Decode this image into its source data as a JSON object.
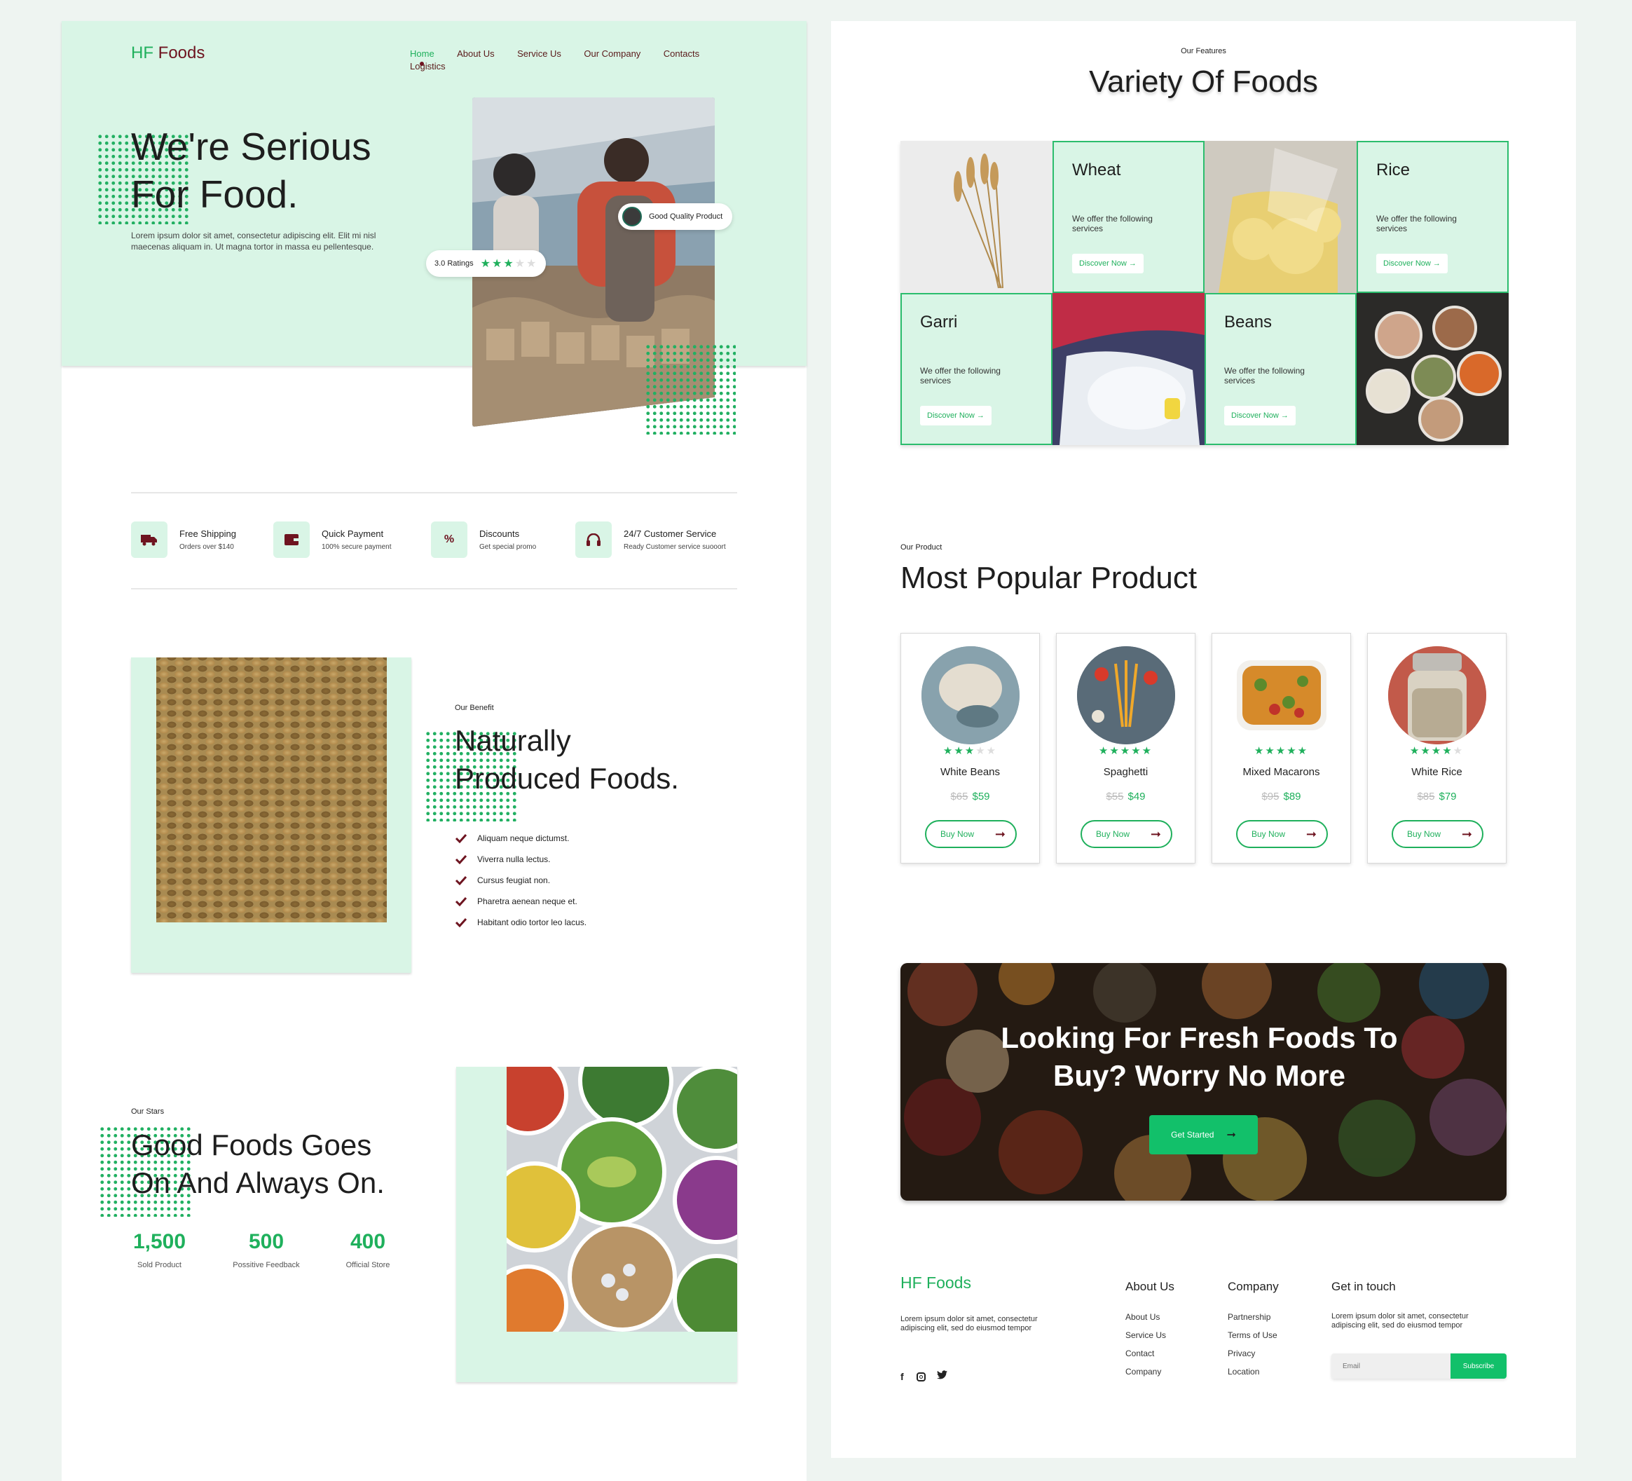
{
  "brand": {
    "hf": "HF",
    "foods": "Foods"
  },
  "nav": {
    "items": [
      "Home",
      "About Us",
      "Service Us",
      "Our Company",
      "Contacts",
      "Logistics"
    ],
    "active": "Home"
  },
  "hero": {
    "title_line1": "We're Serious",
    "title_line2": "For Food.",
    "desc": "Lorem ipsum dolor sit amet, consectetur adipiscing elit. Elit mi nisl maecenas aliquam in. Ut magna tortor in massa eu pellentesque.",
    "badge_quality": "Good Quality Product",
    "badge_ratings": "3.0 Ratings",
    "ratings_value": 3
  },
  "features": [
    {
      "icon": "truck-icon",
      "title": "Free Shipping",
      "sub": "Orders over $140"
    },
    {
      "icon": "wallet-icon",
      "title": "Quick Payment",
      "sub": "100% secure payment"
    },
    {
      "icon": "percent-icon",
      "title": "Discounts",
      "sub": "Get special promo"
    },
    {
      "icon": "headphones-icon",
      "title": "24/7 Customer Service",
      "sub": "Ready Customer service suooort"
    }
  ],
  "benefit": {
    "eyebrow": "Our Benefit",
    "title_line1": "Naturally",
    "title_line2": "Produced Foods.",
    "list": [
      "Aliquam neque dictumst.",
      "Viverra nulla lectus.",
      "Cursus feugiat non.",
      "Pharetra aenean neque et.",
      "Habitant odio tortor leo lacus."
    ]
  },
  "stars_section": {
    "eyebrow": "Our Stars",
    "title_line1": "Good Foods Goes",
    "title_line2": "On And Always On.",
    "stats": [
      {
        "value": "1,500",
        "label": "Sold Product"
      },
      {
        "value": "500",
        "label": "Possitive Feedback"
      },
      {
        "value": "400",
        "label": "Official Store"
      }
    ]
  },
  "variety": {
    "eyebrow": "Our Features",
    "title": "Variety Of Foods",
    "items": [
      {
        "name": "Wheat",
        "desc": "We offer the following services",
        "cta": "Discover Now"
      },
      {
        "name": "Rice",
        "desc": "We offer the following services",
        "cta": "Discover Now"
      },
      {
        "name": "Garri",
        "desc": "We offer the following services",
        "cta": "Discover Now"
      },
      {
        "name": "Beans",
        "desc": "We offer the following services",
        "cta": "Discover Now"
      }
    ]
  },
  "popular": {
    "eyebrow": "Our Product",
    "title": "Most Popular Product",
    "products": [
      {
        "name": "White Beans",
        "old": "$65",
        "price": "$59",
        "rating": 3,
        "cta": "Buy Now"
      },
      {
        "name": "Spaghetti",
        "old": "$55",
        "price": "$49",
        "rating": 5,
        "cta": "Buy Now"
      },
      {
        "name": "Mixed Macarons",
        "old": "$95",
        "price": "$89",
        "rating": 5,
        "cta": "Buy Now"
      },
      {
        "name": "White Rice",
        "old": "$85",
        "price": "$79",
        "rating": 4,
        "cta": "Buy Now"
      }
    ]
  },
  "cta": {
    "line1": "Looking For Fresh Foods To",
    "line2": "Buy? Worry No More",
    "button": "Get Started"
  },
  "footer": {
    "brand": "HF Foods",
    "desc": "Lorem ipsum dolor sit amet, consectetur adipiscing elit, sed do eiusmod tempor",
    "about_title": "About Us",
    "about_links": [
      "About Us",
      "Service Us",
      "Contact",
      "Company"
    ],
    "company_title": "Company",
    "company_links": [
      "Partnership",
      "Terms of Use",
      "Privacy",
      "Location"
    ],
    "touch_title": "Get in touch",
    "touch_desc": "Lorem ipsum dolor sit amet, consectetur adipiscing elit, sed do eiusmod tempor",
    "email_placeholder": "Email",
    "subscribe": "Subscribe",
    "socials": [
      "facebook-icon",
      "instagram-icon",
      "twitter-icon"
    ]
  },
  "colors": {
    "accent": "#1fb05c",
    "mint": "#d9f5e6",
    "maroon": "#6e1420",
    "bg": "#eef4f1"
  }
}
